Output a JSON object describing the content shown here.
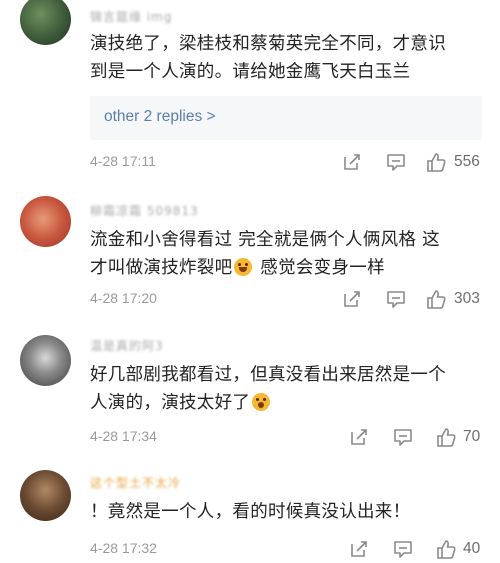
{
  "comments": [
    {
      "username": "锦言筵缘 img",
      "text_line1": "演技绝了，梁桂枝和蔡菊英完全不同，才意识",
      "text_line2": "到是一个人演的。请给她金鹰飞天白玉兰",
      "replies_label": "other 2 replies >",
      "time": "4-28 17:11",
      "likes": "556",
      "avatar_color": "#3d5a3a"
    },
    {
      "username": "柳霜凉霜 509813",
      "text_line1": "流金和小舍得看过 完全就是俩个人俩风格 这",
      "text_line2_a": "才叫做演技炸裂吧",
      "text_line2_b": " 感觉会变身一样",
      "emoji": "grinning-face",
      "time": "4-28 17:20",
      "likes": "303",
      "avatar_color": "#c8573f"
    },
    {
      "username": "温是真的阿3",
      "text_line1": "好几部剧我都看过，但真没看出来居然是一个",
      "text_line2_a": "人演的，演技太好了",
      "emoji": "screaming-face",
      "time": "4-28 17:34",
      "likes": "70",
      "avatar_color": "#5c5c5c"
    },
    {
      "username": "这个型土不太冷",
      "text_line1": "！竟然是一个人，看的时候真没认出来！",
      "time": "4-28 17:32",
      "likes": "40",
      "avatar_color": "#6b4a32"
    }
  ],
  "colors": {
    "time": "#9a9a9a",
    "link": "#5b7fa8",
    "username_vip": "#e8a23a"
  },
  "icons": [
    "share-icon",
    "comment-icon",
    "thumbs-up-icon"
  ]
}
